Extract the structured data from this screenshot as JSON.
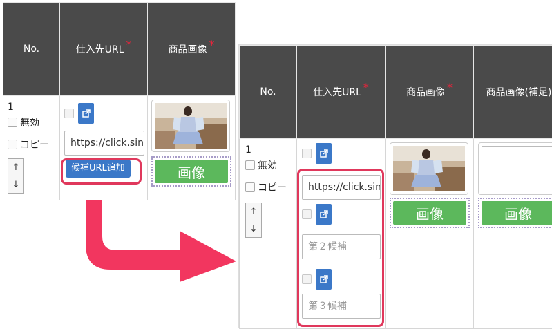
{
  "before": {
    "headers": {
      "no": "No.",
      "url": "仕入先URL",
      "image": "商品画像",
      "required_mark": "*"
    },
    "row": {
      "number": "1",
      "disable_label": "無効",
      "copy_label": "コピー",
      "up_arrow": "↑",
      "down_arrow": "↓",
      "url_value": "https://click.sin",
      "add_candidate_label": "候補URL追加",
      "image_button_label": "画像"
    }
  },
  "after": {
    "headers": {
      "no": "No.",
      "url": "仕入先URL",
      "image": "商品画像",
      "image_supplement": "商品画像(補足)",
      "required_mark": "*"
    },
    "row": {
      "number": "1",
      "disable_label": "無効",
      "copy_label": "コピー",
      "up_arrow": "↑",
      "down_arrow": "↓",
      "url_value": "https://click.sin",
      "candidate2_placeholder": "第２候補",
      "candidate3_placeholder": "第３候補",
      "image_button_label": "画像",
      "supplement_image_button_label": "画像"
    }
  },
  "icons": {
    "external_link": "external-link-icon",
    "arrow": "curved-arrow-right"
  },
  "colors": {
    "header_bg": "#4a4a4a",
    "required": "#e8243b",
    "primary_blue": "#3b78c8",
    "image_green": "#5cb85c",
    "highlight_red": "#e0385c",
    "arrow_pink": "#f2365f"
  }
}
